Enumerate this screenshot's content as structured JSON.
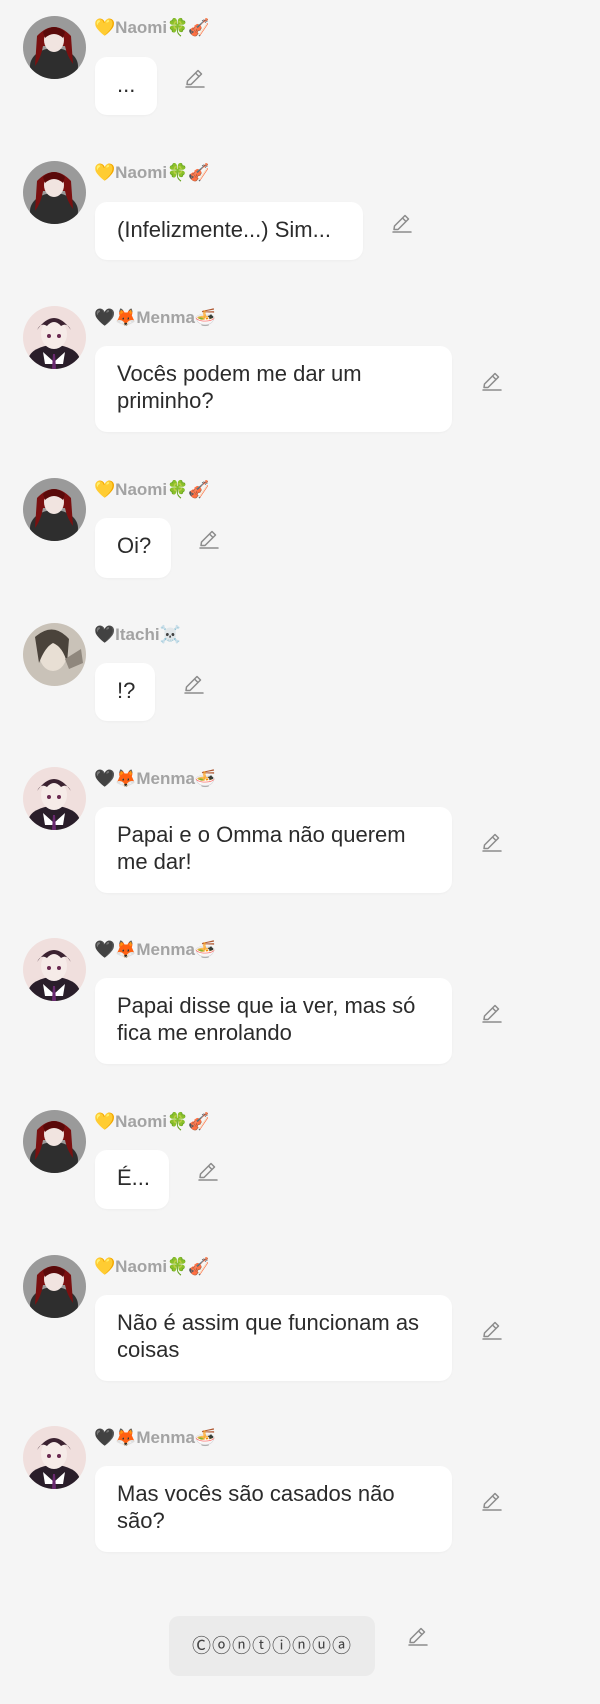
{
  "messages": [
    {
      "author": "💛Naomi🍀🎻",
      "text": "...",
      "avatar": "naomi"
    },
    {
      "author": "💛Naomi🍀🎻",
      "text": "(Infelizmente...) Sim...",
      "avatar": "naomi"
    },
    {
      "author": "🖤🦊Menma🍜",
      "text": "Vocês podem me dar um priminho?",
      "avatar": "menma"
    },
    {
      "author": "💛Naomi🍀🎻",
      "text": "Oi?",
      "avatar": "naomi"
    },
    {
      "author": "🖤Itachi☠️",
      "text": "!?",
      "avatar": "itachi"
    },
    {
      "author": "🖤🦊Menma🍜",
      "text": "Papai e o Omma não querem me dar!",
      "avatar": "menma"
    },
    {
      "author": "🖤🦊Menma🍜",
      "text": "Papai disse que ia ver, mas só fica me enrolando",
      "avatar": "menma"
    },
    {
      "author": "💛Naomi🍀🎻",
      "text": "É...",
      "avatar": "naomi"
    },
    {
      "author": "💛Naomi🍀🎻",
      "text": "Não é assim que funcionam as coisas",
      "avatar": "naomi"
    },
    {
      "author": "🖤🦊Menma🍜",
      "text": "Mas vocês são casados não são?",
      "avatar": "menma"
    }
  ],
  "continue_label": "Ⓒⓞⓝⓣⓘⓝⓤⓐ",
  "icons": {
    "edit": "pencil-icon"
  }
}
